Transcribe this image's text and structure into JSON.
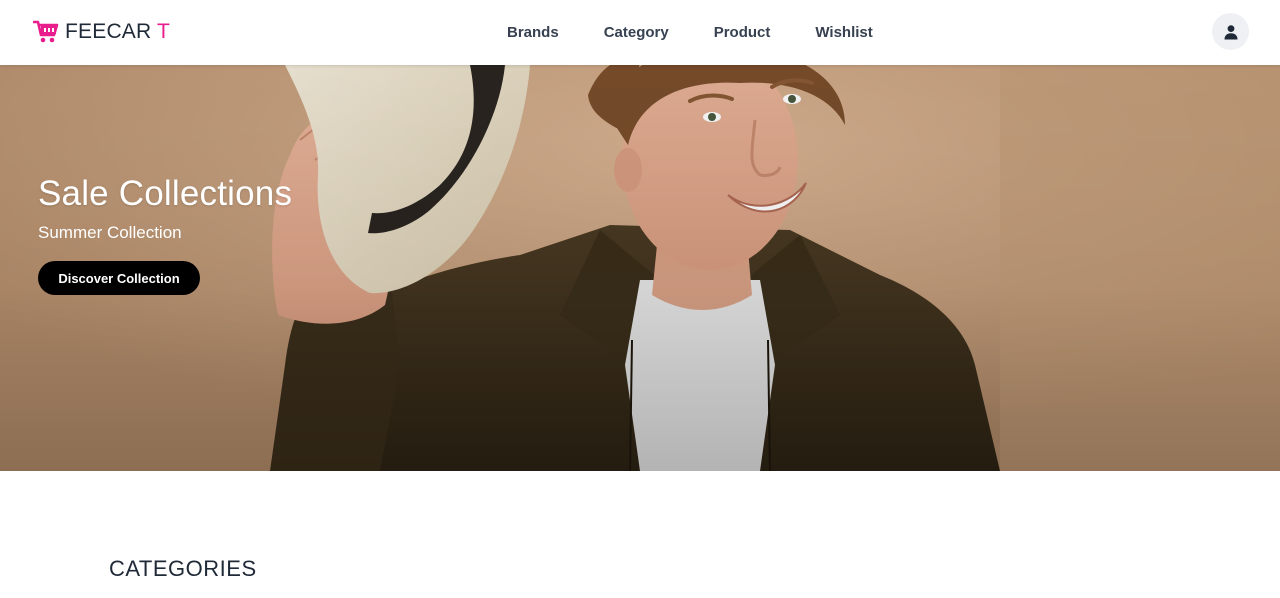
{
  "brand": {
    "name_main": "FEECAR",
    "name_accent": "T",
    "accent_color": "#e91e8c",
    "icon": "cart-icon"
  },
  "nav": {
    "items": [
      {
        "label": "Brands"
      },
      {
        "label": "Category"
      },
      {
        "label": "Product"
      },
      {
        "label": "Wishlist"
      }
    ]
  },
  "user": {
    "icon": "user-icon"
  },
  "hero": {
    "title": "Sale Collections",
    "subtitle": "Summer Collection",
    "cta_label": "Discover Collection"
  },
  "categories": {
    "title": "CATEGORIES"
  }
}
